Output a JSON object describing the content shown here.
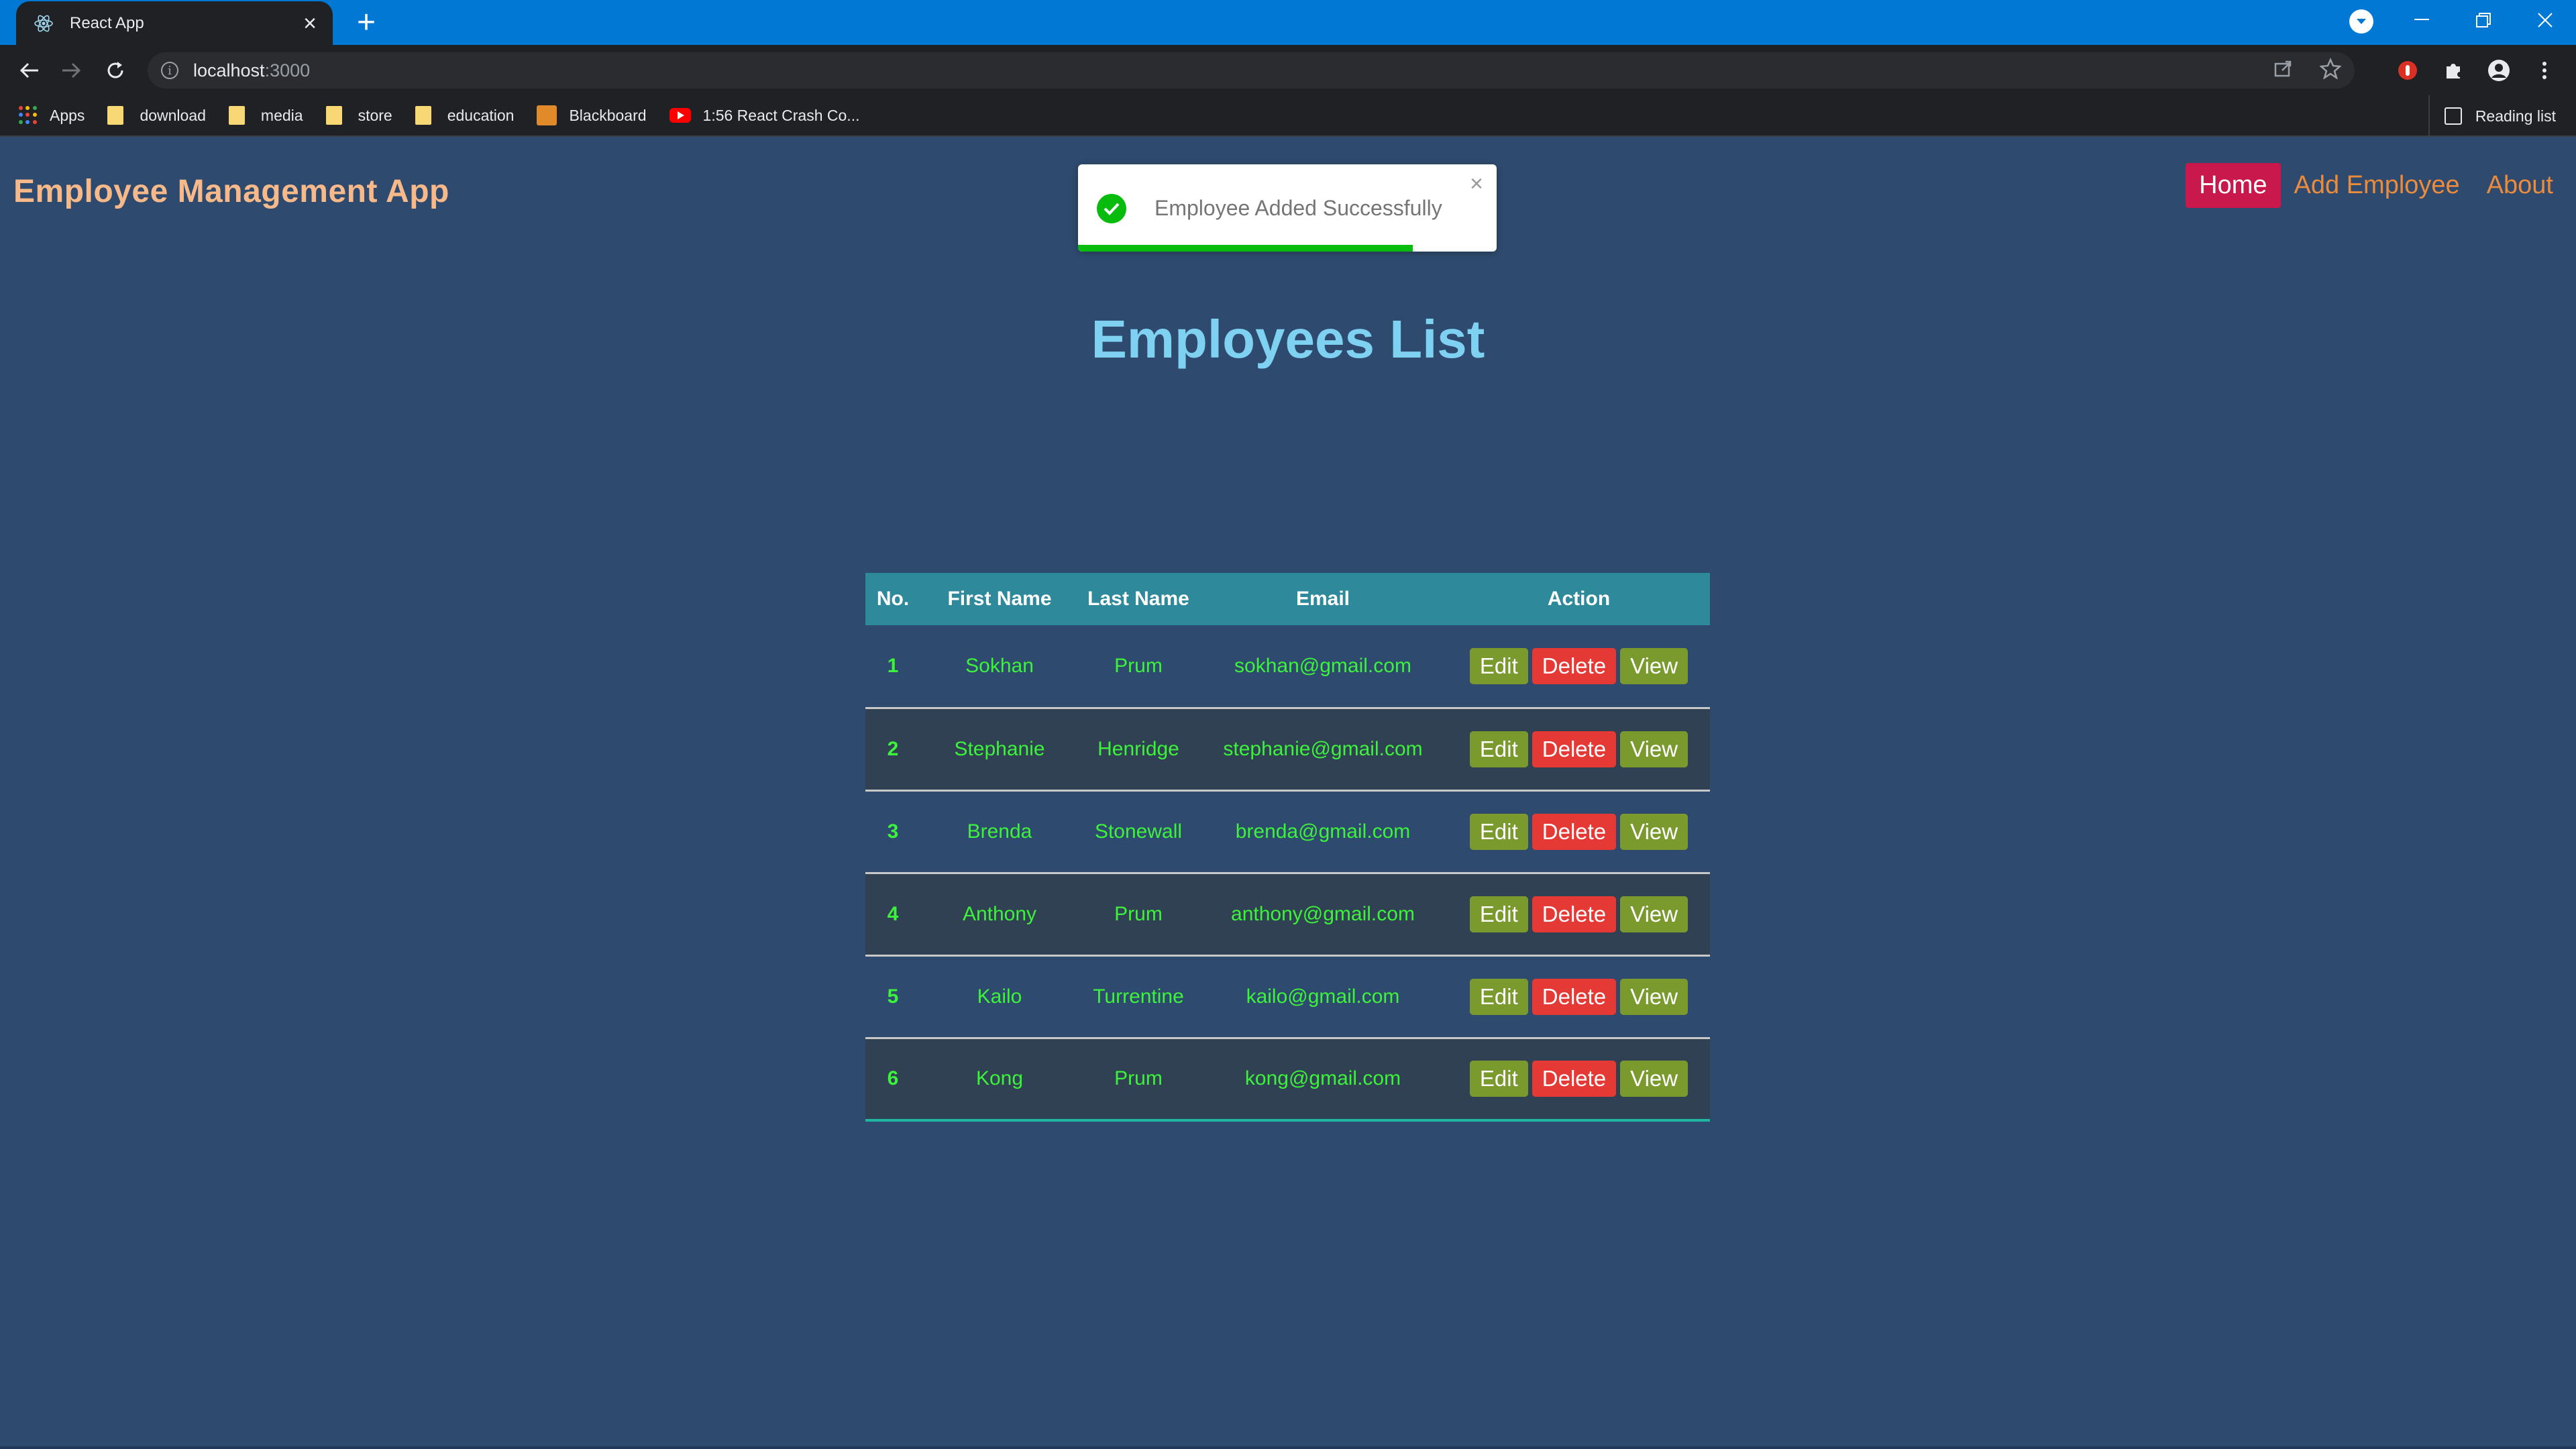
{
  "browser": {
    "tab_title": "React App",
    "new_tab_symbol": "+",
    "url_host": "localhost",
    "url_port": ":3000",
    "bookmarks": [
      {
        "label": "Apps",
        "icon": "apps-grid-icon"
      },
      {
        "label": "download",
        "icon": "folder-icon"
      },
      {
        "label": "media",
        "icon": "folder-icon"
      },
      {
        "label": "store",
        "icon": "folder-icon"
      },
      {
        "label": "education",
        "icon": "folder-icon"
      },
      {
        "label": "Blackboard",
        "icon": "blackboard-icon"
      },
      {
        "label": "1:56 React Crash Co...",
        "icon": "youtube-icon"
      }
    ],
    "reading_list": "Reading list"
  },
  "header": {
    "app_title": "Employee Management App",
    "nav": [
      "Home",
      "Add Employee",
      "About"
    ],
    "active_nav": "Home"
  },
  "toast": {
    "message": "Employee Added Successfully",
    "progress": 0.8
  },
  "main": {
    "title": "Employees List",
    "columns": [
      "No.",
      "First Name",
      "Last Name",
      "Email",
      "Action"
    ],
    "actions": [
      "Edit",
      "Delete",
      "View"
    ],
    "rows": [
      {
        "no": "1",
        "first": "Sokhan",
        "last": "Prum",
        "email": "sokhan@gmail.com"
      },
      {
        "no": "2",
        "first": "Stephanie",
        "last": "Henridge",
        "email": "stephanie@gmail.com"
      },
      {
        "no": "3",
        "first": "Brenda",
        "last": "Stonewall",
        "email": "brenda@gmail.com"
      },
      {
        "no": "4",
        "first": "Anthony",
        "last": "Prum",
        "email": "anthony@gmail.com"
      },
      {
        "no": "5",
        "first": "Kailo",
        "last": "Turrentine",
        "email": "kailo@gmail.com"
      },
      {
        "no": "6",
        "first": "Kong",
        "last": "Prum",
        "email": "kong@gmail.com"
      }
    ]
  },
  "colors": {
    "page_bg": "#2e4a6e",
    "title_orange": "#f7b98a",
    "nav_active": "#c8184c",
    "table_header": "#2e8a9a",
    "cell_text": "#3df23a",
    "edit_btn": "#7a9a2e",
    "delete_btn": "#e53935"
  }
}
